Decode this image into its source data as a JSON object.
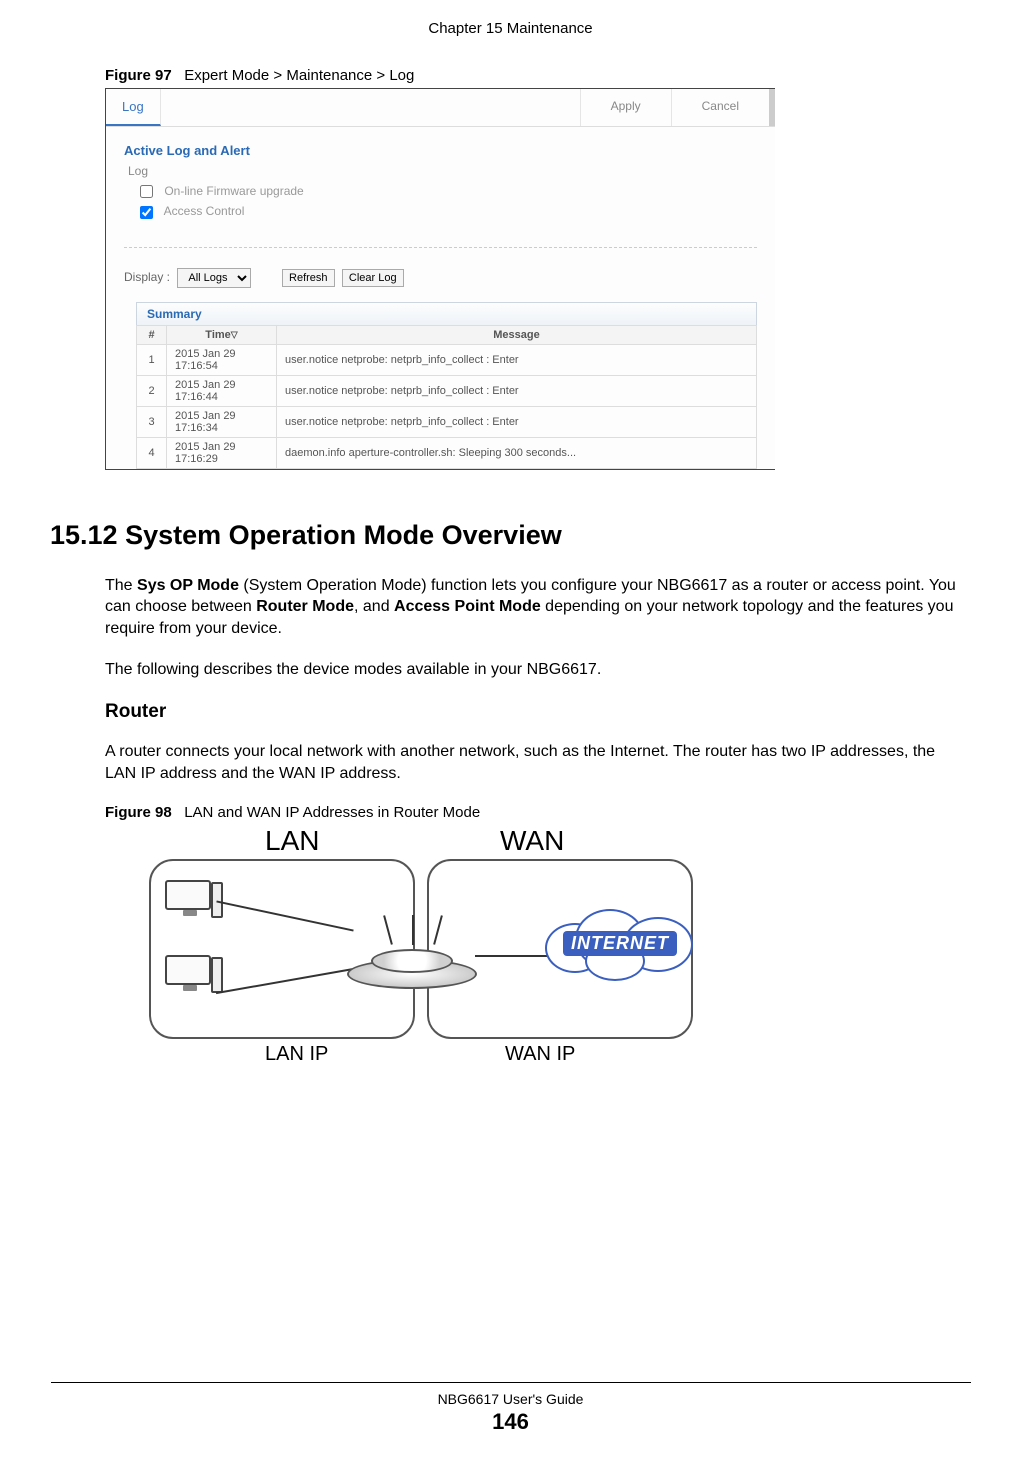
{
  "chapter_header": "Chapter 15 Maintenance",
  "fig97": {
    "caption_label": "Figure 97",
    "caption_text": "Expert Mode > Maintenance > Log",
    "tab": "Log",
    "apply": "Apply",
    "cancel": "Cancel",
    "section_title": "Active Log and Alert",
    "sub_label": "Log",
    "opt1": "On-line Firmware upgrade",
    "opt2": "Access Control",
    "display_label": "Display :",
    "display_value": "All Logs",
    "refresh": "Refresh",
    "clear": "Clear Log",
    "summary": "Summary",
    "th_num": "#",
    "th_time": "Time",
    "th_msg": "Message",
    "rows": [
      {
        "n": "1",
        "t": "2015 Jan 29 17:16:54",
        "m": "user.notice netprobe: netprb_info_collect : Enter"
      },
      {
        "n": "2",
        "t": "2015 Jan 29 17:16:44",
        "m": "user.notice netprobe: netprb_info_collect : Enter"
      },
      {
        "n": "3",
        "t": "2015 Jan 29 17:16:34",
        "m": "user.notice netprobe: netprb_info_collect : Enter"
      },
      {
        "n": "4",
        "t": "2015 Jan 29 17:16:29",
        "m": "daemon.info aperture-controller.sh: Sleeping 300 seconds..."
      }
    ]
  },
  "section": {
    "num_title": "15.12  System Operation Mode Overview",
    "para1_a": "The ",
    "para1_b": "Sys OP Mode",
    "para1_c": " (System Operation Mode) function lets you configure your NBG6617 as a router or access point. You can choose between ",
    "para1_d": "Router Mode",
    "para1_e": ", and ",
    "para1_f": "Access Point Mode",
    "para1_g": " depending on your network topology and the features you require from your device.",
    "para2": "The following describes the device modes available in your NBG6617.",
    "subhead": "Router",
    "para3": "A router connects your local network with another network, such as the Internet. The router has two IP addresses, the LAN IP address and the WAN IP address."
  },
  "fig98": {
    "caption_label": "Figure 98",
    "caption_text": "LAN and WAN IP Addresses in Router Mode",
    "lan": "LAN",
    "wan": "WAN",
    "lan_ip": "LAN IP",
    "wan_ip": "WAN IP",
    "internet": "INTERNET"
  },
  "footer": {
    "guide": "NBG6617 User's Guide",
    "page": "146"
  }
}
